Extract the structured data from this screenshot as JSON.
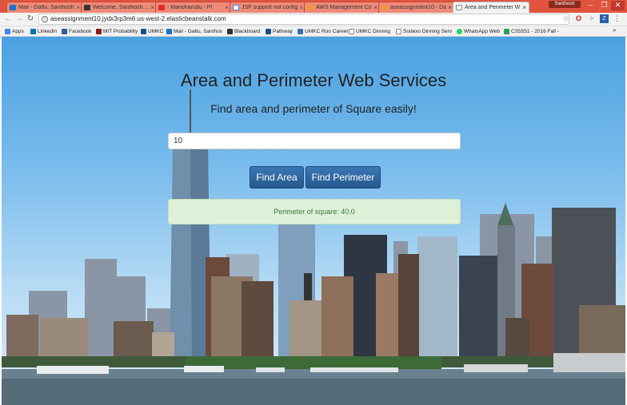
{
  "browser": {
    "tabs": [
      {
        "label": "Mail - Gattu, Santhosh",
        "icon_color": "#1a73c8",
        "icon": "mail-icon",
        "active": false
      },
      {
        "label": "Welcome, Santhosh Ka",
        "icon_color": "#333333",
        "icon": "blackboard-icon",
        "active": false
      },
      {
        "label": "- Manoharudu - Pl",
        "icon_color": "#e52d27",
        "icon": "youtube-icon",
        "active": false
      },
      {
        "label": "JSP support not config",
        "icon_color": "#4285f4",
        "icon": "google-icon",
        "active": false
      },
      {
        "label": "AWS Management Co",
        "icon_color": "#f29a2e",
        "icon": "aws-icon",
        "active": false
      },
      {
        "label": "aseassignment10 - Da",
        "icon_color": "#f29a2e",
        "icon": "aws-icon",
        "active": false
      },
      {
        "label": "Area and Perimeter W",
        "icon_color": "#ffffff",
        "icon": "page-icon",
        "active": true
      }
    ],
    "profile_name": "Santhosh",
    "url": "aseassignment10.jydx3rp3m6.us-west-2.elasticbeanstalk.com",
    "bookmarks": [
      {
        "label": "Apps",
        "icon_color": "#4285f4"
      },
      {
        "label": "Linkedin",
        "icon_color": "#0077b5"
      },
      {
        "label": "Facebook",
        "icon_color": "#3b5998"
      },
      {
        "label": "MIT Probability",
        "icon_color": "#8b1a1a"
      },
      {
        "label": "UMKC",
        "icon_color": "#1b4f8f"
      },
      {
        "label": "Mail - Gattu, Santhos",
        "icon_color": "#1a73c8"
      },
      {
        "label": "Blackboard",
        "icon_color": "#333333"
      },
      {
        "label": "Pathway",
        "icon_color": "#1b4f8f"
      },
      {
        "label": "UMKC Roo Career",
        "icon_color": "#3a6fb5"
      },
      {
        "label": "UMKC Dinning",
        "icon_color": "#ffffff"
      },
      {
        "label": "Sodexo Dinning Serv",
        "icon_color": "#ffffff"
      },
      {
        "label": "WhatsApp Web",
        "icon_color": "#25d366"
      },
      {
        "label": "CS5551 - 2016 Fall -",
        "icon_color": "#2e9e4f"
      }
    ],
    "more_bookmarks": "»"
  },
  "page": {
    "title": "Area and Perimeter Web Services",
    "subtitle": "Find area and perimeter of Square easily!",
    "input_value": "10",
    "find_area_label": "Find Area",
    "find_perimeter_label": "Find Perimeter",
    "result_text": "Perimeter of square: 40.0"
  },
  "colors": {
    "chrome_titlebar": "#e0543e",
    "button_primary": "#26598e",
    "result_background": "#dff0d8",
    "result_text": "#3c763d"
  }
}
